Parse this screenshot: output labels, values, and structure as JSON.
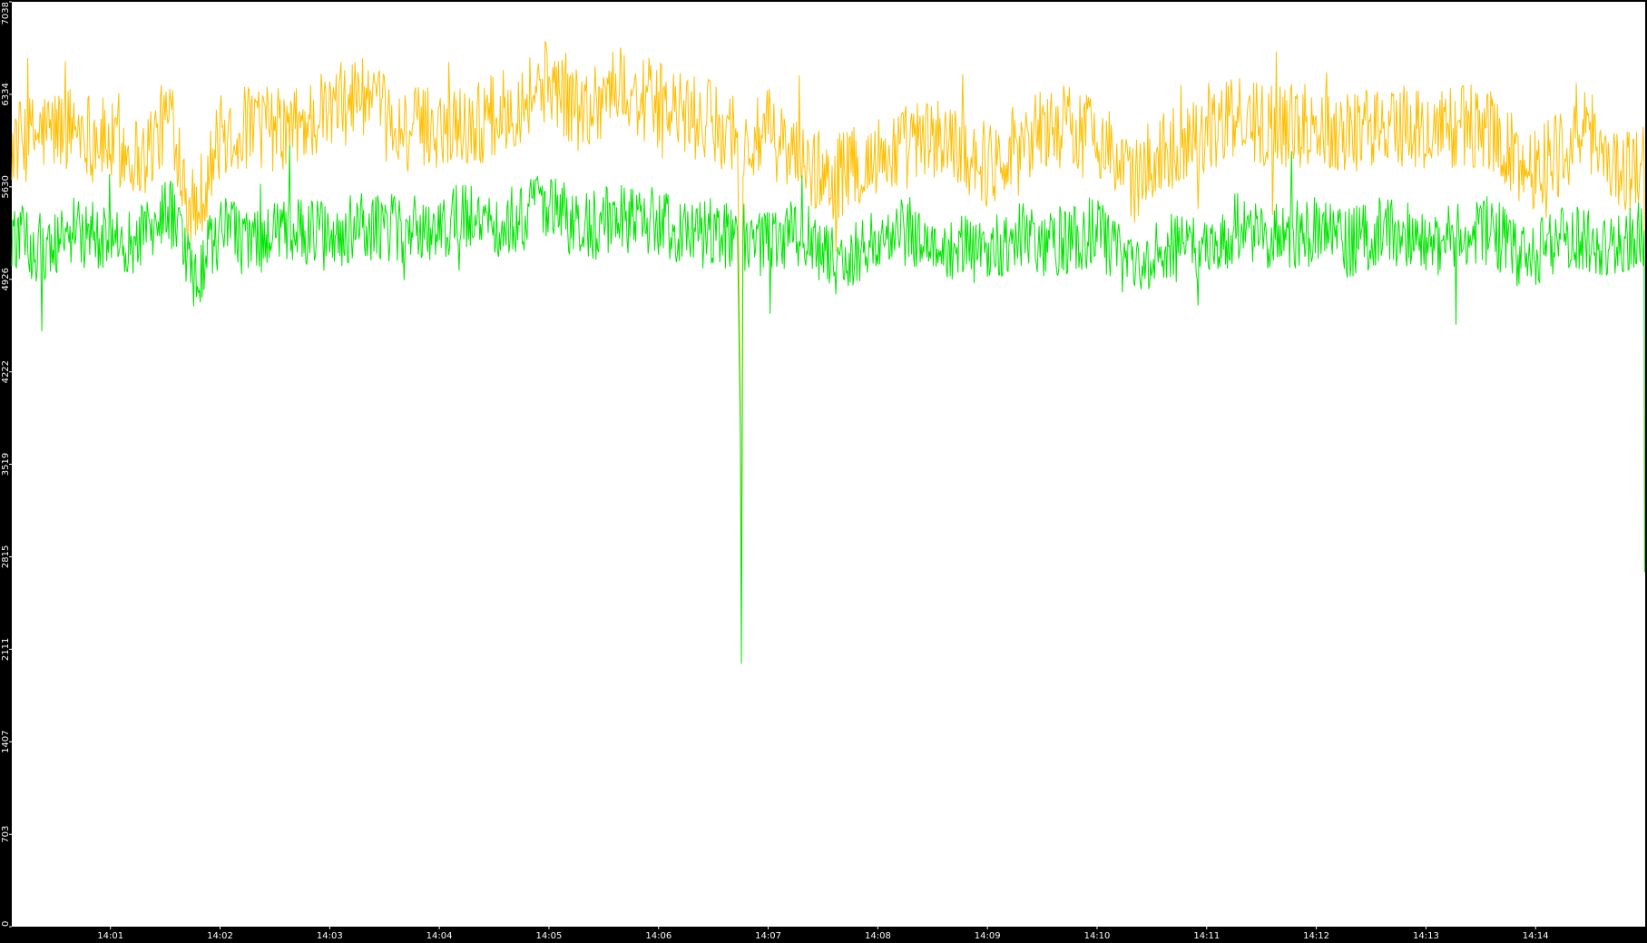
{
  "chart_data": {
    "type": "line",
    "title": "",
    "xlabel": "",
    "ylabel": "",
    "grid": false,
    "legend": "none",
    "colors": {
      "background": "#000000",
      "plot_area": "#ffffff",
      "axis_text": "#ffffff",
      "axis_line": "#000000"
    },
    "ylim": [
      0,
      7038
    ],
    "y_ticks": [
      0,
      703,
      1407,
      2111,
      2815,
      3519,
      4222,
      4926,
      5630,
      6334,
      7038
    ],
    "x_range_minutes": [
      840.1,
      855
    ],
    "x_ticks": [
      "14:01",
      "14:02",
      "14:03",
      "14:04",
      "14:05",
      "14:06",
      "14:07",
      "14:08",
      "14:09",
      "14:10",
      "14:11",
      "14:12",
      "14:13",
      "14:14"
    ],
    "x_tick_minutes": [
      841,
      842,
      843,
      844,
      845,
      846,
      847,
      848,
      849,
      850,
      851,
      852,
      853,
      854
    ],
    "series": [
      {
        "color": "#ffbf00",
        "values": [
          [
            840.1,
            5950
          ],
          [
            840.4,
            6050
          ],
          [
            840.7,
            6100
          ],
          [
            841.0,
            5950
          ],
          [
            841.3,
            5850
          ],
          [
            841.55,
            6200
          ],
          [
            841.75,
            5400
          ],
          [
            842.0,
            6000
          ],
          [
            842.3,
            6100
          ],
          [
            842.6,
            6050
          ],
          [
            843.0,
            6200
          ],
          [
            843.3,
            6350
          ],
          [
            843.6,
            6050
          ],
          [
            844.0,
            6100
          ],
          [
            844.3,
            6100
          ],
          [
            844.6,
            6200
          ],
          [
            845.0,
            6450
          ],
          [
            845.3,
            6200
          ],
          [
            845.6,
            6400
          ],
          [
            846.0,
            6250
          ],
          [
            846.3,
            6150
          ],
          [
            846.55,
            6100
          ],
          [
            846.72,
            6050
          ],
          [
            846.745,
            4100
          ],
          [
            846.755,
            2300
          ],
          [
            846.77,
            5900
          ],
          [
            847.0,
            6050
          ],
          [
            847.3,
            5800
          ],
          [
            847.6,
            5700
          ],
          [
            848.0,
            5850
          ],
          [
            848.3,
            5950
          ],
          [
            848.6,
            6000
          ],
          [
            849.0,
            5800
          ],
          [
            849.3,
            6000
          ],
          [
            849.6,
            6100
          ],
          [
            850.0,
            6050
          ],
          [
            850.3,
            5650
          ],
          [
            850.6,
            5900
          ],
          [
            851.0,
            6050
          ],
          [
            851.3,
            6150
          ],
          [
            851.6,
            6100
          ],
          [
            852.0,
            6100
          ],
          [
            852.3,
            6050
          ],
          [
            852.6,
            6100
          ],
          [
            853.0,
            6050
          ],
          [
            853.3,
            6100
          ],
          [
            853.6,
            6050
          ],
          [
            853.9,
            5750
          ],
          [
            854.2,
            5900
          ],
          [
            854.5,
            6050
          ],
          [
            854.75,
            5750
          ],
          [
            854.99,
            5800
          ],
          [
            854.995,
            2750
          ]
        ]
      },
      {
        "color": "#00e600",
        "values": [
          [
            840.1,
            5250
          ],
          [
            840.4,
            5150
          ],
          [
            840.7,
            5300
          ],
          [
            841.0,
            5200
          ],
          [
            841.3,
            5250
          ],
          [
            841.55,
            5450
          ],
          [
            841.75,
            4900
          ],
          [
            842.0,
            5300
          ],
          [
            842.3,
            5200
          ],
          [
            842.6,
            5300
          ],
          [
            843.0,
            5250
          ],
          [
            843.3,
            5350
          ],
          [
            843.6,
            5300
          ],
          [
            844.0,
            5350
          ],
          [
            844.3,
            5400
          ],
          [
            844.6,
            5350
          ],
          [
            845.0,
            5500
          ],
          [
            845.3,
            5300
          ],
          [
            845.6,
            5400
          ],
          [
            846.0,
            5350
          ],
          [
            846.3,
            5300
          ],
          [
            846.55,
            5200
          ],
          [
            846.72,
            5300
          ],
          [
            846.745,
            3800
          ],
          [
            846.755,
            2000
          ],
          [
            846.77,
            5250
          ],
          [
            847.0,
            5200
          ],
          [
            847.3,
            5300
          ],
          [
            847.6,
            5050
          ],
          [
            848.0,
            5200
          ],
          [
            848.3,
            5300
          ],
          [
            848.6,
            5200
          ],
          [
            849.0,
            5150
          ],
          [
            849.3,
            5250
          ],
          [
            849.6,
            5200
          ],
          [
            850.0,
            5300
          ],
          [
            850.3,
            5000
          ],
          [
            850.6,
            5200
          ],
          [
            851.0,
            5100
          ],
          [
            851.3,
            5350
          ],
          [
            851.6,
            5250
          ],
          [
            852.0,
            5300
          ],
          [
            852.3,
            5200
          ],
          [
            852.6,
            5300
          ],
          [
            853.0,
            5200
          ],
          [
            853.3,
            5250
          ],
          [
            853.6,
            5300
          ],
          [
            853.9,
            5050
          ],
          [
            854.2,
            5200
          ],
          [
            854.5,
            5250
          ],
          [
            854.75,
            5150
          ],
          [
            854.99,
            5300
          ],
          [
            854.995,
            2700
          ]
        ]
      }
    ]
  }
}
